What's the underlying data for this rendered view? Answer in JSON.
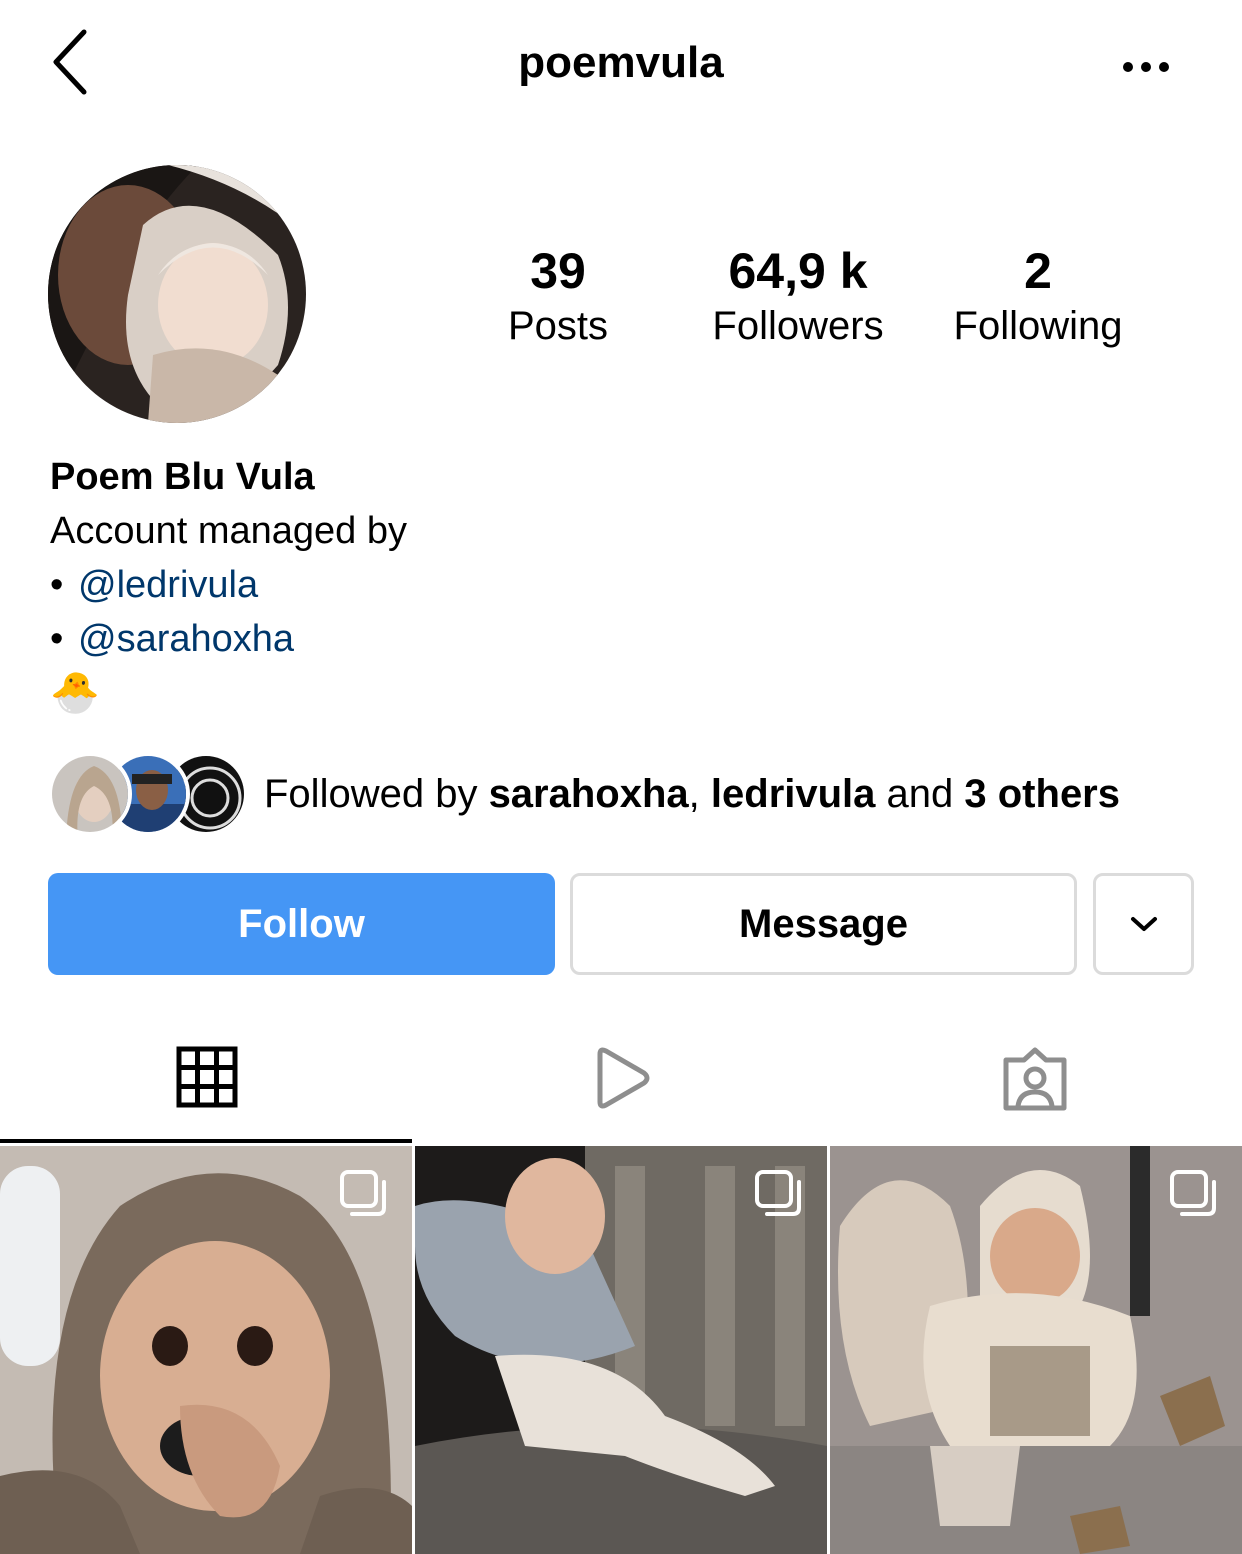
{
  "header": {
    "username": "poemvula",
    "back_icon": "chevron-left-icon",
    "more_icon": "more-horizontal-icon"
  },
  "stats": {
    "posts": {
      "value": "39",
      "label": "Posts"
    },
    "followers": {
      "value": "64,9 k",
      "label": "Followers"
    },
    "following": {
      "value": "2",
      "label": "Following"
    }
  },
  "bio": {
    "name": "Poem Blu Vula",
    "line1": "Account managed by",
    "bullet": "•",
    "mention1": "@ledrivula",
    "mention2": "@sarahoxha",
    "emoji": "🐣"
  },
  "followed_by": {
    "prefix": "Followed by ",
    "user1": "sarahoxha",
    "sep": ", ",
    "user2": "ledrivula",
    "and": " and ",
    "others": "3 others"
  },
  "actions": {
    "follow_label": "Follow",
    "message_label": "Message",
    "more_icon": "chevron-down-icon"
  },
  "tabs": [
    {
      "name": "grid-icon",
      "active": true
    },
    {
      "name": "reels-icon",
      "active": false
    },
    {
      "name": "tagged-icon",
      "active": false
    }
  ],
  "colors": {
    "follow_button": "#4596f5",
    "mention": "#00376b",
    "border": "#dbdbdb"
  }
}
